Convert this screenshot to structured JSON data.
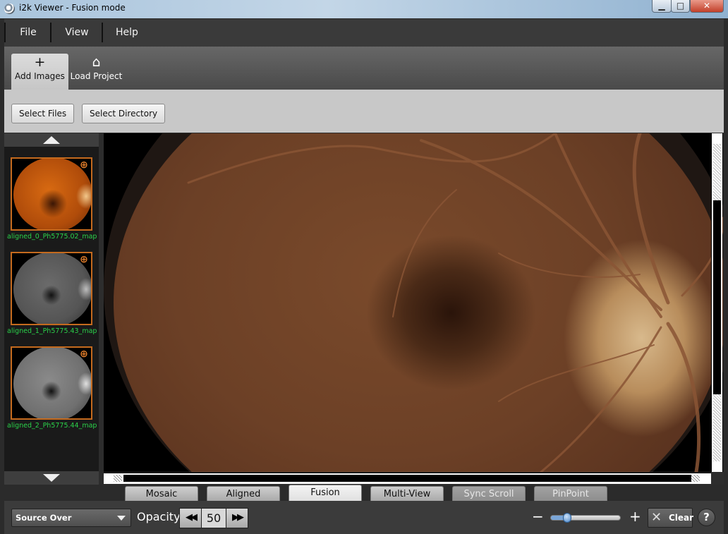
{
  "window": {
    "title": "i2k Viewer - Fusion mode",
    "controls": {
      "minimize": "▁",
      "maximize": "□",
      "close": "✕"
    }
  },
  "menu": [
    "File",
    "View",
    "Help"
  ],
  "toolbar": {
    "add_images": {
      "label": "Add Images",
      "icon": "plus-icon",
      "glyph": "+"
    },
    "load_project": {
      "label": "Load Project",
      "icon": "house-outline-icon",
      "glyph": "⌂"
    }
  },
  "subtoolbar": {
    "select_files": "Select Files",
    "select_directory": "Select Directory"
  },
  "images": [
    {
      "label": "aligned_0_Ph5775.02_map",
      "kind": "color-fundus"
    },
    {
      "label": "aligned_1_Ph5775.43_map",
      "kind": "angiogram"
    },
    {
      "label": "aligned_2_Ph5775.44_map",
      "kind": "angiogram-bright"
    }
  ],
  "view_tabs": [
    {
      "label": "Mosaic",
      "state": "normal"
    },
    {
      "label": "Aligned",
      "state": "normal"
    },
    {
      "label": "Fusion",
      "state": "active"
    },
    {
      "label": "Multi-View",
      "state": "normal"
    },
    {
      "label": "Sync Scroll",
      "state": "disabled"
    },
    {
      "label": "PinPoint",
      "state": "disabled"
    }
  ],
  "bottom": {
    "blend_mode": "Source Over",
    "opacity_label": "Opacity",
    "opacity_value": "50",
    "prev_glyph": "◀◀",
    "next_glyph": "▶▶",
    "zoom_minus": "−",
    "zoom_plus": "+",
    "zoom_level": 0.2,
    "clear_label": "Clear",
    "clear_glyph": "✕",
    "help_glyph": "?"
  },
  "colors": {
    "thumb_border": "#c46a1e",
    "thumb_label": "#2ad14a"
  }
}
